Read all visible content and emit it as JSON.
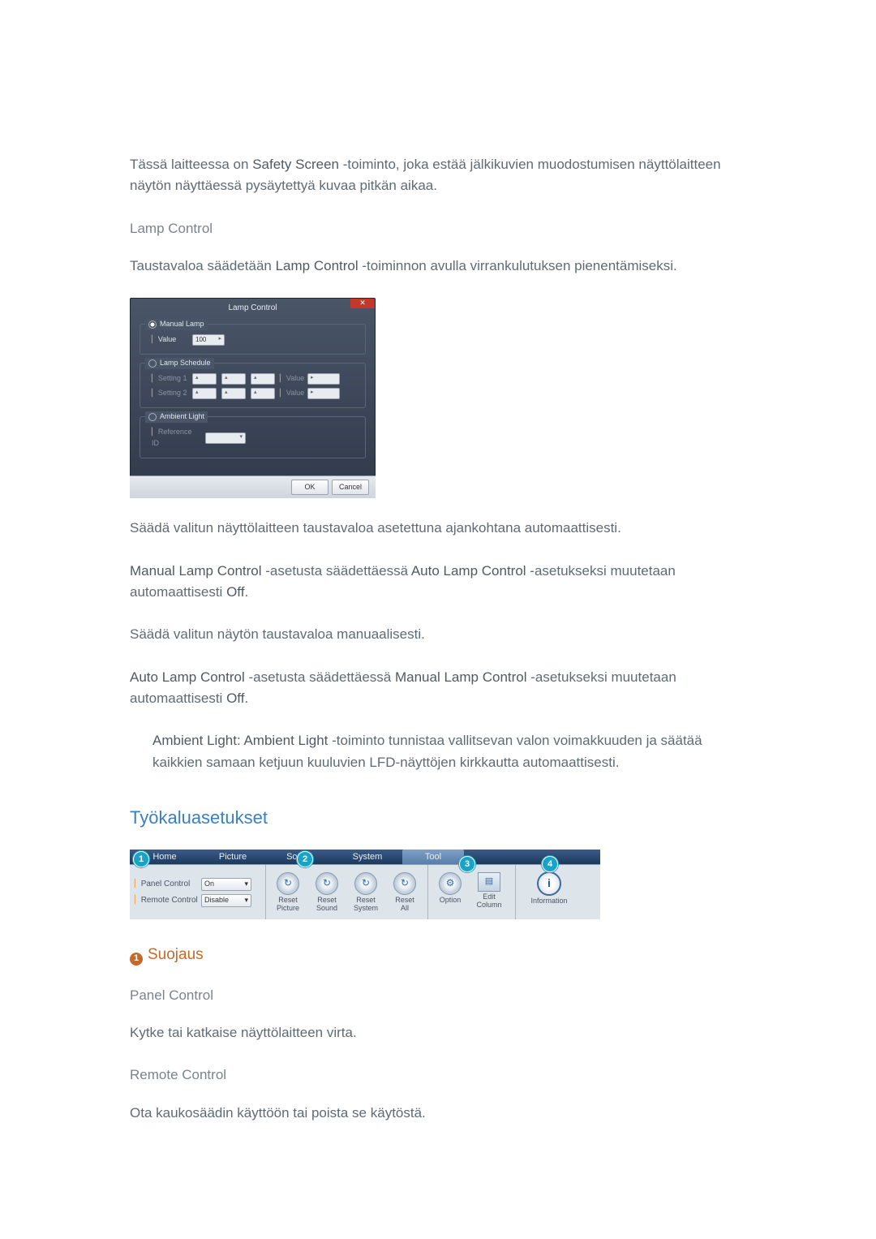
{
  "intro": {
    "text1a": "Tässä laitteessa on ",
    "strong1": "Safety Screen",
    "text1b": " -toiminto, joka estää jälkikuvien muodostumisen näyttölaitteen näytön näyttäessä pysäytettyä kuvaa pitkän aikaa."
  },
  "lamp": {
    "heading": "Lamp Control",
    "desc_a": "Taustavaloa säädetään ",
    "desc_strong": "Lamp Control",
    "desc_b": " -toiminnon avulla virrankulutuksen pienentämiseksi.",
    "after_dlg": "Säädä valitun näyttölaitteen taustavaloa asetettuna ajankohtana automaattisesti.",
    "manual_a": "Manual Lamp Control",
    "manual_mid": " -asetusta säädettäessä ",
    "manual_b": "Auto Lamp Control",
    "manual_c": " -asetukseksi muutetaan automaattisesti ",
    "manual_off": "Off",
    "manual_end": ".",
    "manual_line2": "Säädä valitun näytön taustavaloa manuaalisesti.",
    "auto_a": "Auto Lamp Control",
    "auto_mid": " -asetusta säädettäessä ",
    "auto_b": "Manual Lamp Control",
    "auto_c": " -asetukseksi muutetaan automaattisesti ",
    "auto_off": "Off",
    "auto_end": ".",
    "ambient_strong": "Ambient Light: Ambient Light",
    "ambient_text": " -toiminto tunnistaa vallitsevan valon voimakkuuden ja säätää kaikkien samaan ketjuun kuuluvien LFD-näyttöjen kirkkautta automaattisesti."
  },
  "dlg": {
    "title": "Lamp Control",
    "manual_legend": "Manual Lamp",
    "value_lbl": "Value",
    "value_val": "100",
    "schedule_legend": "Lamp Schedule",
    "setting1": "Setting 1",
    "setting2": "Setting 2",
    "sched_value_lbl": "Value",
    "ambient_legend": "Ambient Light",
    "reference_lbl": "Reference ID",
    "ok": "OK",
    "cancel": "Cancel"
  },
  "tool": {
    "section_title": "Työkaluasetukset",
    "tabs": {
      "home": "Home",
      "picture": "Picture",
      "sound": "Sound",
      "system": "System",
      "tool": "Tool"
    },
    "left": {
      "panel_lbl": "Panel Control",
      "panel_val": "On",
      "remote_lbl": "Remote Control",
      "remote_val": "Disable"
    },
    "reset": {
      "picture": "Reset\nPicture",
      "sound": "Reset\nSound",
      "system": "Reset\nSystem",
      "all": "Reset\nAll"
    },
    "right": {
      "option": "Option",
      "edit": "Edit\nColumn",
      "info": "Information"
    },
    "callouts": {
      "c1": "1",
      "c2": "2",
      "c3": "3",
      "c4": "4"
    }
  },
  "sec1": {
    "badge": "1",
    "title": "Suojaus",
    "panel_head": "Panel Control",
    "panel_text": "Kytke tai katkaise näyttölaitteen virta.",
    "remote_head": "Remote Control",
    "remote_text": "Ota kaukosäädin käyttöön tai poista se käytöstä."
  },
  "icons": {
    "close_glyph": "✕",
    "down_glyph": "▾",
    "spin_glyph": "▸",
    "updown_glyph": "▴",
    "reset_glyph": "↻",
    "gear_glyph": "⚙",
    "grid_glyph": "▤",
    "info_glyph": "i"
  }
}
